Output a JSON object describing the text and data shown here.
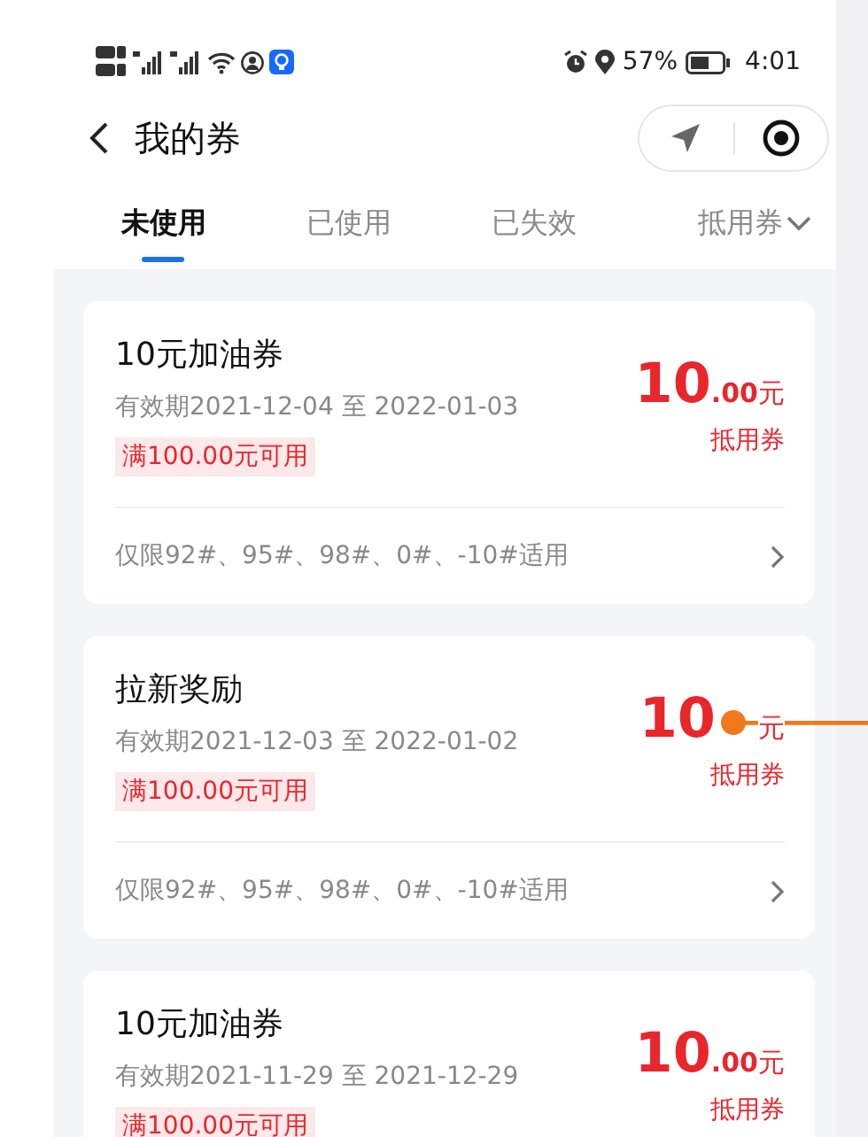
{
  "status_bar": {
    "battery_text": "57%",
    "time": "4:01"
  },
  "header": {
    "title": "我的券"
  },
  "tabs": [
    {
      "label": "未使用",
      "selected": true,
      "kind": "tab"
    },
    {
      "label": "已使用",
      "selected": false,
      "kind": "tab"
    },
    {
      "label": "已失效",
      "selected": false,
      "kind": "tab"
    },
    {
      "label": "抵用券",
      "selected": false,
      "kind": "dropdown"
    }
  ],
  "coupons": [
    {
      "title": "10元加油券",
      "validity": "有效期2021-12-04 至 2022-01-03",
      "condition": "满100.00元可用",
      "amount": "10",
      "cents": ".00",
      "unit": "元",
      "type": "抵用券",
      "scope": "仅限92#、95#、98#、0#、-10#适用"
    },
    {
      "title": "拉新奖励",
      "validity": "有效期2021-12-03 至 2022-01-02",
      "condition": "满100.00元可用",
      "amount": "10",
      "unit": "元",
      "type": "抵用券",
      "scope": "仅限92#、95#、98#、0#、-10#适用"
    },
    {
      "title": "10元加油券",
      "validity": "有效期2021-11-29 至 2021-12-29",
      "condition": "满100.00元可用",
      "amount": "10",
      "cents": ".00",
      "unit": "元",
      "type": "抵用券"
    }
  ]
}
